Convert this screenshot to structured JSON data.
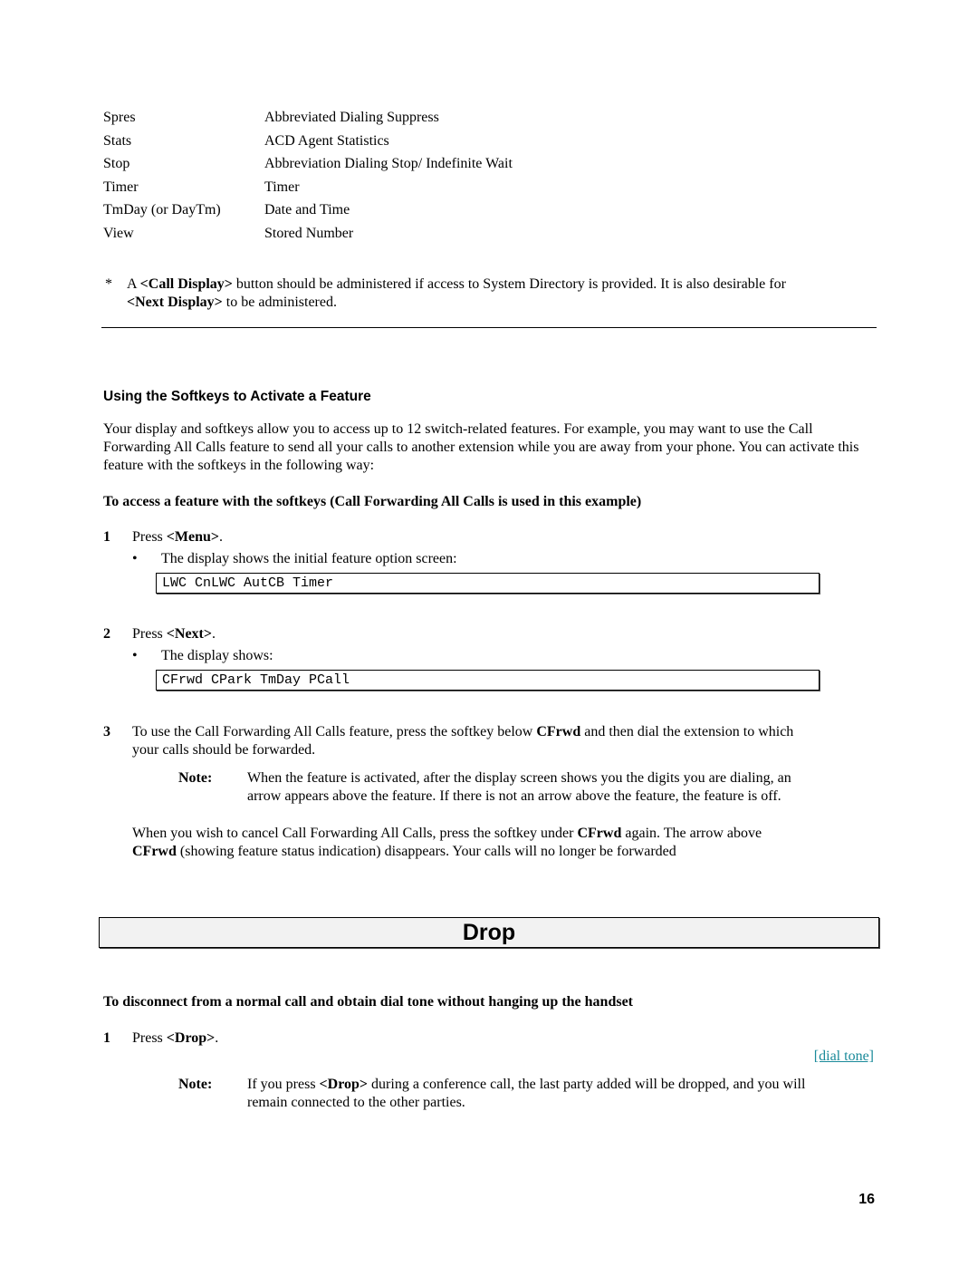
{
  "abbreviations": [
    {
      "abbr": "Spres",
      "desc": "Abbreviated Dialing Suppress"
    },
    {
      "abbr": "Stats",
      "desc": "ACD Agent Statistics"
    },
    {
      "abbr": "Stop",
      "desc": "Abbreviation Dialing Stop/ Indefinite Wait"
    },
    {
      "abbr": "Timer",
      "desc": "Timer"
    },
    {
      "abbr": "TmDay (or DayTm)",
      "desc": "Date and Time"
    },
    {
      "abbr": "View",
      "desc": "Stored Number"
    }
  ],
  "footnote": {
    "marker": "*",
    "pre": "A ",
    "bold1": "<Call Display>",
    "mid": " button should be administered if access to System Directory is provided.  It is also desirable for",
    "bold2": "<Next Display>",
    "post": " to be administered."
  },
  "softkeys_section": {
    "heading": "Using the Softkeys to Activate a Feature",
    "intro": "Your display and softkeys allow you to access up to 12 switch-related features.  For example, you may want to use the Call Forwarding All Calls feature to send all your calls to another extension while you are away from your phone.  You can activate this feature with the softkeys in the following way:",
    "procedure_title": "To access a feature with the softkeys (Call Forwarding All Calls is used in this example)",
    "steps": [
      {
        "num": "1",
        "pre": "Press ",
        "bold": "<Menu>",
        "post": ".",
        "bullet": "The display shows the initial feature option screen:",
        "display": "LWC CnLWC AutCB Timer"
      },
      {
        "num": "2",
        "pre": "Press ",
        "bold": "<Next>",
        "post": ".",
        "bullet": "The display shows:",
        "display": "CFrwd CPark TmDay PCall"
      },
      {
        "num": "3",
        "line1_pre": "To use the Call Forwarding All Calls feature, press the softkey below ",
        "line1_bold": "CFrwd",
        "line1_post": " and then dial the extension to which",
        "line2": "your calls should be forwarded."
      }
    ],
    "note": {
      "label": "Note:",
      "line1": "When the feature is activated, after the display screen shows you the digits you are dialing, an",
      "line2": "arrow appears above the feature.  If there is not an arrow above the feature, the feature is off."
    },
    "cancel": {
      "pre": "When you wish to cancel Call Forwarding All Calls, press the softkey under ",
      "bold1": "CFrwd",
      "mid": " again.  The arrow above",
      "bold2": "CFrwd",
      "post": " (showing feature status indication) disappears.  Your calls will no longer be forwarded"
    }
  },
  "drop_section": {
    "banner": "Drop",
    "procedure_title": "To disconnect from a normal call and obtain dial tone without hanging up the handset",
    "step": {
      "num": "1",
      "pre": "Press ",
      "bold": "<Drop>",
      "post": "."
    },
    "result_link": "[dial tone]",
    "note": {
      "label": "Note:",
      "pre": "If you press ",
      "bold": "<Drop>",
      "post": " during a conference call, the last party added will be dropped, and you will",
      "line2": "remain connected to the other parties."
    }
  },
  "page_number": "16",
  "colors": {
    "link": "#1a8a9a",
    "banner_bg": "#f2f2f2"
  }
}
